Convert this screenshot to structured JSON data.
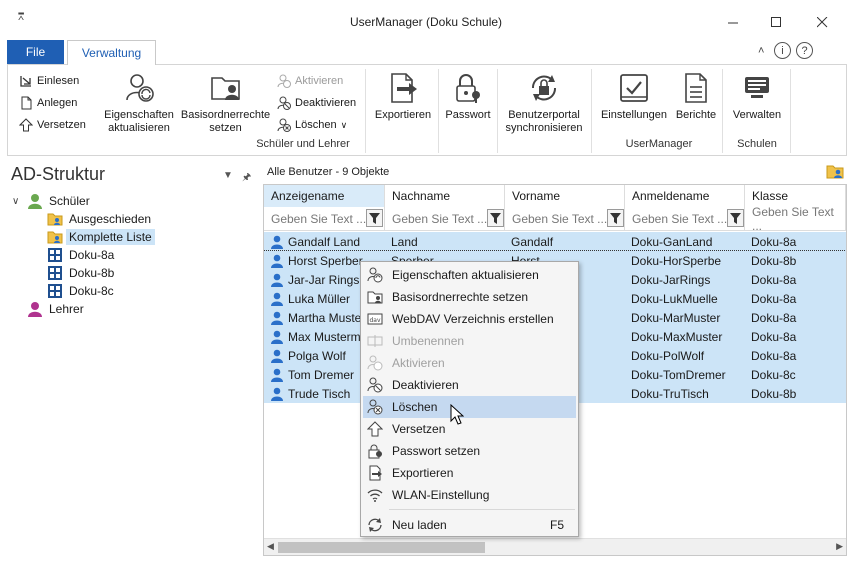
{
  "window": {
    "title": "UserManager (Doku Schule)",
    "qat_icon": "qat-arrow-icon",
    "controls": [
      "minimize-icon",
      "maximize-icon",
      "close-icon"
    ]
  },
  "ribbon": {
    "tabs": [
      {
        "label": "File",
        "active": false
      },
      {
        "label": "Verwaltung",
        "active": true
      }
    ],
    "groups": [
      {
        "label": "Schüler und Lehrer",
        "small_buttons_left": [
          {
            "label": "Einlesen",
            "icon": "import-icon"
          },
          {
            "label": "Anlegen",
            "icon": "new-document-icon"
          },
          {
            "label": "Versetzen",
            "icon": "up-arrow-icon"
          }
        ],
        "big_buttons": [
          {
            "label": "Eigenschaften aktualisieren",
            "line1": "Eigenschaften",
            "line2": "aktualisieren",
            "icon": "users-refresh-icon"
          },
          {
            "label": "Basisordnerrechte setzen",
            "line1": "Basisordnerrechte",
            "line2": "setzen",
            "icon": "folder-user-icon"
          }
        ],
        "small_buttons_right": [
          {
            "label": "Aktivieren",
            "icon": "users-check-icon",
            "disabled": true
          },
          {
            "label": "Deaktivieren",
            "icon": "users-block-icon",
            "disabled": false
          },
          {
            "label": "Löschen",
            "icon": "users-delete-icon",
            "disabled": false,
            "dropdown": true
          }
        ],
        "export_buttons": [
          {
            "label": "Exportieren",
            "icon": "export-icon"
          },
          {
            "label": "Passwort",
            "icon": "lock-key-icon"
          },
          {
            "label": "Benutzerportal synchronisieren",
            "line1": "Benutzerportal",
            "line2": "synchronisieren",
            "icon": "sync-lock-icon"
          }
        ]
      },
      {
        "label": "UserManager",
        "big_buttons": [
          {
            "label": "Einstellungen",
            "icon": "settings-check-icon"
          },
          {
            "label": "Berichte",
            "icon": "report-icon"
          }
        ]
      },
      {
        "label": "Schulen",
        "big_buttons": [
          {
            "label": "Verwalten",
            "icon": "manage-icon"
          }
        ]
      }
    ]
  },
  "left_panel": {
    "title": "AD-Struktur",
    "tree": [
      {
        "label": "Schüler",
        "level": 0,
        "icon": "user-green-icon",
        "expanded": true
      },
      {
        "label": "Ausgeschieden",
        "level": 1,
        "icon": "folder-users-icon"
      },
      {
        "label": "Komplette Liste",
        "level": 1,
        "icon": "folder-users-icon",
        "selected": true
      },
      {
        "label": "Doku-8a",
        "level": 1,
        "icon": "class-grid-icon"
      },
      {
        "label": "Doku-8b",
        "level": 1,
        "icon": "class-grid-icon"
      },
      {
        "label": "Doku-8c",
        "level": 1,
        "icon": "class-grid-icon"
      },
      {
        "label": "Lehrer",
        "level": 0,
        "icon": "user-purple-icon"
      }
    ]
  },
  "main": {
    "header": "Alle Benutzer - 9 Objekte",
    "columns": [
      "Anzeigename",
      "Nachname",
      "Vorname",
      "Anmeldename",
      "Klasse"
    ],
    "filter_placeholder": "Geben Sie Text ...",
    "rows": [
      [
        "Gandalf Land",
        "Land",
        "Gandalf",
        "Doku-GanLand",
        "Doku-8a"
      ],
      [
        "Horst Sperber",
        "Sperber",
        "Horst",
        "Doku-HorSperbe",
        "Doku-8b"
      ],
      [
        "Jar-Jar Rings",
        "",
        "",
        "Doku-JarRings",
        "Doku-8a"
      ],
      [
        "Luka Müller",
        "",
        "",
        "Doku-LukMuelle",
        "Doku-8a"
      ],
      [
        "Martha Muster",
        "",
        "",
        "Doku-MarMuster",
        "Doku-8a"
      ],
      [
        "Max Mustermann",
        "",
        "",
        "Doku-MaxMuster",
        "Doku-8a"
      ],
      [
        "Polga Wolf",
        "",
        "",
        "Doku-PolWolf",
        "Doku-8a"
      ],
      [
        "Tom Dremer",
        "",
        "",
        "Doku-TomDremer",
        "Doku-8c"
      ],
      [
        "Trude Tisch",
        "",
        "",
        "Doku-TruTisch",
        "Doku-8b"
      ]
    ]
  },
  "context_menu": {
    "items": [
      {
        "label": "Eigenschaften aktualisieren",
        "icon": "users-refresh-icon"
      },
      {
        "label": "Basisordnerrechte setzen",
        "icon": "folder-user-icon"
      },
      {
        "label": "WebDAV Verzeichnis erstellen",
        "icon": "webdav-icon"
      },
      {
        "label": "Umbenennen",
        "icon": "rename-icon",
        "disabled": true
      },
      {
        "label": "Aktivieren",
        "icon": "users-check-icon",
        "disabled": true
      },
      {
        "label": "Deaktivieren",
        "icon": "users-block-icon"
      },
      {
        "label": "Löschen",
        "icon": "users-delete-icon",
        "hover": true
      },
      {
        "label": "Versetzen",
        "icon": "up-arrow-icon"
      },
      {
        "label": "Passwort setzen",
        "icon": "lock-key-icon"
      },
      {
        "label": "Exportieren",
        "icon": "export-icon"
      },
      {
        "label": "WLAN-Einstellung",
        "icon": "wifi-icon"
      },
      {
        "label": "Neu laden",
        "icon": "reload-icon",
        "shortcut": "F5"
      }
    ]
  },
  "colors": {
    "accent": "#1f5fb4",
    "selection": "#cce4f7",
    "menu_hover": "#c5d9f0",
    "user_blue": "#2a6fc9"
  }
}
